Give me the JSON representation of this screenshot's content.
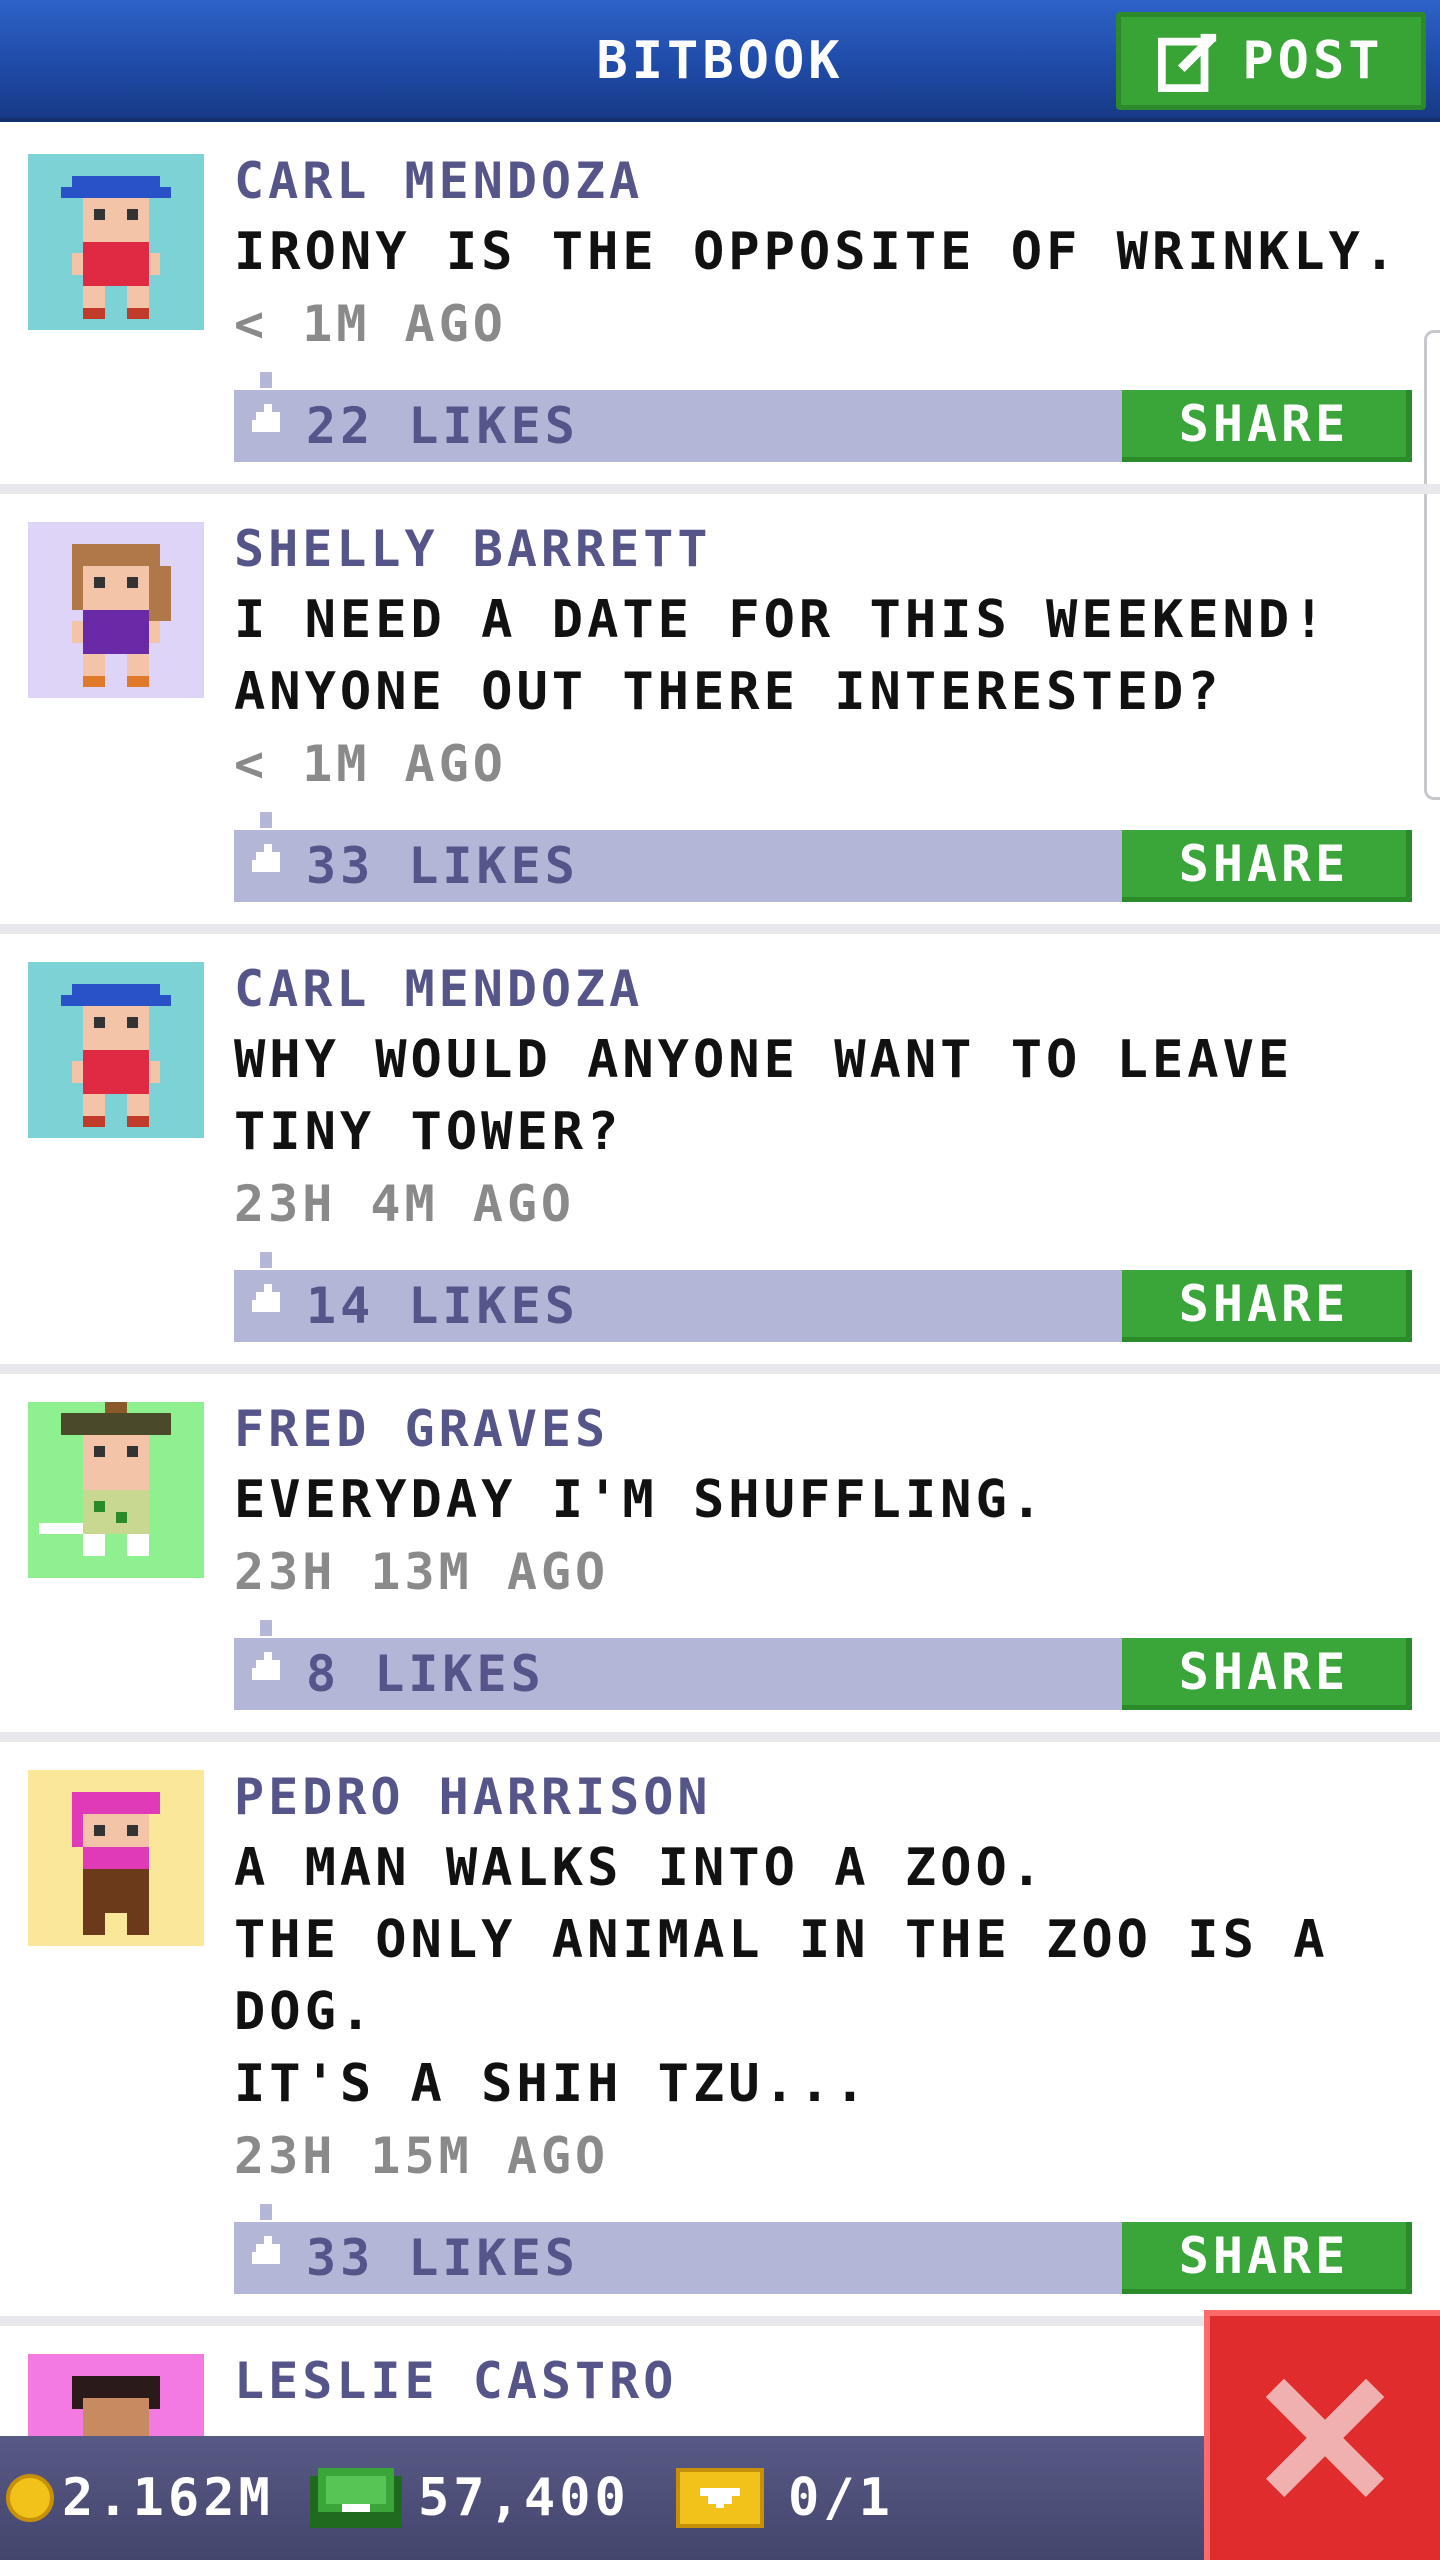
{
  "header": {
    "title": "BITBOOK",
    "post_label": "POST"
  },
  "posts": [
    {
      "author": "CARL MENDOZA",
      "message": "IRONY IS THE OPPOSITE OF WRINKLY.",
      "time": "< 1M AGO",
      "likes": "22 LIKES",
      "share": "SHARE",
      "avatar_bg": "#7dd2d6"
    },
    {
      "author": "SHELLY BARRETT",
      "message": "I NEED A DATE FOR THIS WEEKEND!\nANYONE OUT THERE INTERESTED?",
      "time": "< 1M AGO",
      "likes": "33 LIKES",
      "share": "SHARE",
      "avatar_bg": "#ddd4f8"
    },
    {
      "author": "CARL MENDOZA",
      "message": "WHY WOULD ANYONE WANT TO LEAVE\nTINY TOWER?",
      "time": "23H 4M AGO",
      "likes": "14 LIKES",
      "share": "SHARE",
      "avatar_bg": "#7dd2d6"
    },
    {
      "author": "FRED GRAVES",
      "message": "EVERYDAY I'M SHUFFLING.",
      "time": "23H 13M AGO",
      "likes": "8 LIKES",
      "share": "SHARE",
      "avatar_bg": "#8ff08f"
    },
    {
      "author": "PEDRO HARRISON",
      "message": "A MAN WALKS INTO A ZOO.\nTHE ONLY ANIMAL IN THE ZOO IS A\nDOG.\nIT'S A SHIH TZU...",
      "time": "23H 15M AGO",
      "likes": "33 LIKES",
      "share": "SHARE",
      "avatar_bg": "#fbe79a"
    },
    {
      "author": "LESLIE CASTRO",
      "avatar_bg": "#f27ae0"
    }
  ],
  "status": {
    "coins": "2.162M",
    "bux": "57,400",
    "tickets": "0/1"
  },
  "colors": {
    "header": "#2352b4",
    "accent_green": "#3aa539",
    "like_bar": "#b4b6d8",
    "close_red": "#e02c2c"
  }
}
